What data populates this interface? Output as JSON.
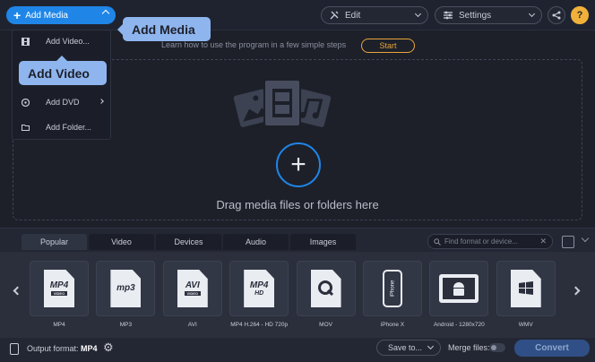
{
  "toolbar": {
    "add_media": "Add Media",
    "edit": "Edit",
    "settings": "Settings",
    "share_icon": "share-icon",
    "help_label": "?"
  },
  "add_media_menu": {
    "items": [
      {
        "label": "Add Video...",
        "icon": "film-icon"
      },
      {
        "label": "",
        "icon": "camera-icon"
      },
      {
        "label": "Add DVD",
        "icon": "disc-icon"
      },
      {
        "label": "Add Folder...",
        "icon": "folder-icon"
      }
    ]
  },
  "tooltips": {
    "add_media": "Add Media",
    "add_video": "Add Video"
  },
  "tutorial": {
    "text": "Learn how to use the program in a few simple steps",
    "start": "Start"
  },
  "dropzone": {
    "text": "Drag media files or folders here"
  },
  "format_panel": {
    "tabs": [
      {
        "label": "Popular",
        "active": true
      },
      {
        "label": "Video",
        "active": false
      },
      {
        "label": "Devices",
        "active": false
      },
      {
        "label": "Audio",
        "active": false
      },
      {
        "label": "Images",
        "active": false
      }
    ],
    "search_placeholder": "Find format or device...",
    "presets": [
      {
        "label": "MP4",
        "icon": "mp4-file-icon",
        "badge": "MP4",
        "sub": "VIDEO"
      },
      {
        "label": "MP3",
        "icon": "mp3-file-icon",
        "badge": "mp3",
        "sub": ""
      },
      {
        "label": "AVI",
        "icon": "avi-file-icon",
        "badge": "AVI",
        "sub": "VIDEO"
      },
      {
        "label": "MP4 H.264 - HD 720p",
        "icon": "mp4-hd-file-icon",
        "badge": "MP4",
        "sub": "HD"
      },
      {
        "label": "MOV",
        "icon": "quicktime-icon",
        "badge": "",
        "sub": ""
      },
      {
        "label": "iPhone X",
        "icon": "iphone-icon",
        "badge": "iPhone",
        "sub": ""
      },
      {
        "label": "Android - 1280x720",
        "icon": "android-tablet-icon",
        "badge": "",
        "sub": ""
      },
      {
        "label": "WMV",
        "icon": "windows-file-icon",
        "badge": "",
        "sub": ""
      }
    ]
  },
  "statusbar": {
    "output_format_label": "Output format:",
    "output_format_value": "MP4",
    "save_to": "Save to...",
    "merge_files": "Merge files:",
    "convert": "Convert"
  },
  "colors": {
    "accent": "#1f86e8",
    "start_outline": "#e8a53a",
    "help_bg": "#f0b13a",
    "tooltip_bg": "#8fb5ef",
    "background": "#1d2029"
  }
}
